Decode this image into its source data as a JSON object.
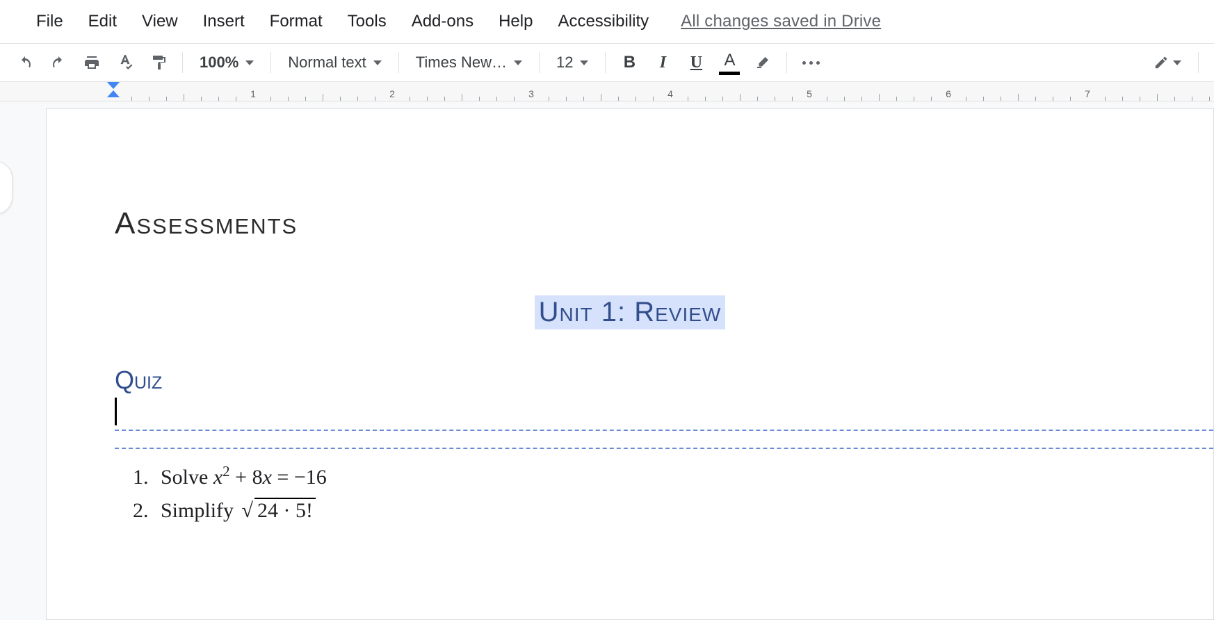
{
  "menus": {
    "file": "File",
    "edit": "Edit",
    "view": "View",
    "insert": "Insert",
    "format": "Format",
    "tools": "Tools",
    "addons": "Add-ons",
    "help": "Help",
    "accessibility": "Accessibility"
  },
  "save_status": "All changes saved in Drive",
  "toolbar": {
    "zoom": "100%",
    "para_style": "Normal text",
    "font": "Times New…",
    "fontsize": "12",
    "bold_glyph": "B",
    "italic_glyph": "I",
    "underline_glyph": "U",
    "textcolor_glyph": "A"
  },
  "ruler": {
    "numbers": [
      "1",
      "2",
      "3",
      "4",
      "5",
      "6",
      "7"
    ]
  },
  "doc": {
    "title": "Assessments",
    "subtitle": "Unit 1: Review",
    "section": "Quiz",
    "q1_intro": "Solve ",
    "q1_math": "x² + 8x = −16",
    "q2_intro": "Simplify ",
    "q2_radicand": "24 · 5!"
  }
}
